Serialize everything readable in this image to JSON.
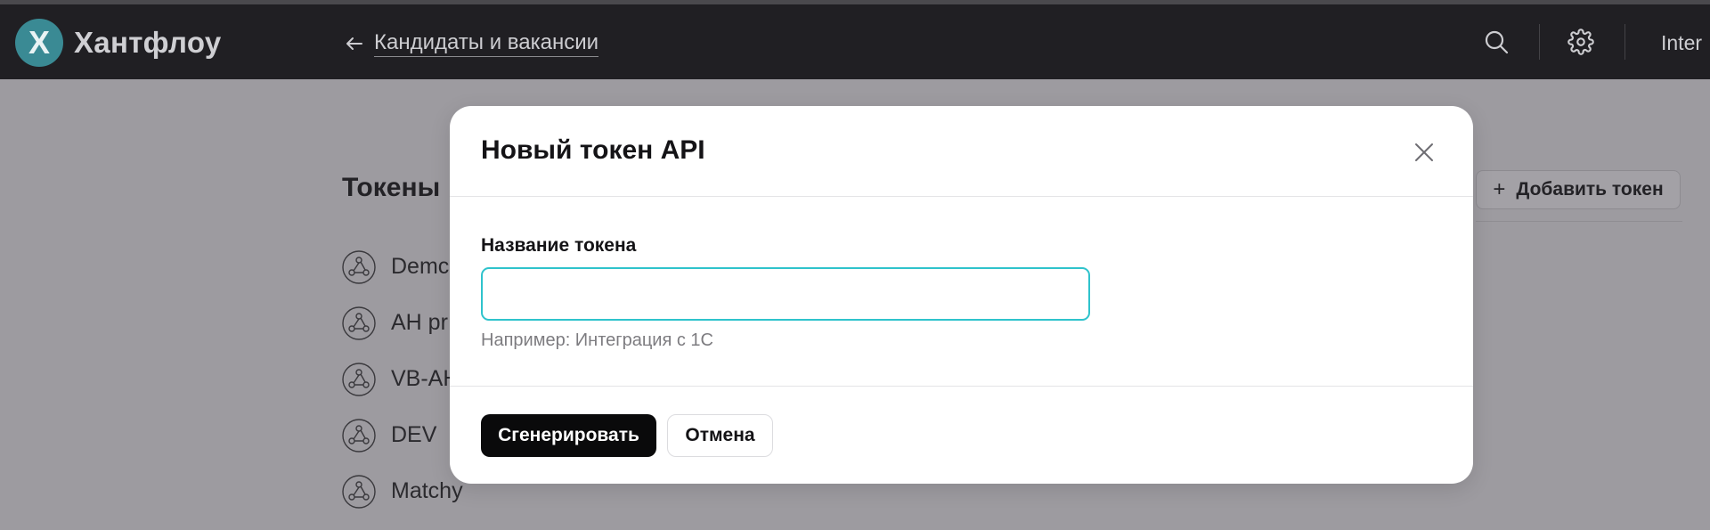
{
  "header": {
    "logo_letter": "X",
    "app_name": "Хантфлоу",
    "back_link": "Кандидаты и вакансии",
    "user_label": "Inter"
  },
  "page": {
    "title": "Токены",
    "add_token_button": "Добавить токен",
    "tokens": [
      {
        "name": "Demc"
      },
      {
        "name": "AH pr"
      },
      {
        "name": "VB-AH"
      },
      {
        "name": "DEV"
      },
      {
        "name": "Matchy"
      }
    ]
  },
  "modal": {
    "title": "Новый токен API",
    "field_label": "Название токена",
    "field_value": "",
    "field_hint": "Например: Интеграция с 1С",
    "generate_button": "Сгенерировать",
    "cancel_button": "Отмена"
  },
  "colors": {
    "header_bg": "#201f23",
    "logo_bg": "#3a8a94",
    "input_focus_border": "#2fc3cc",
    "primary_button_bg": "#0a0a0b",
    "overlay": "#9d9ba0"
  },
  "icons": {
    "back": "arrow-left-icon",
    "search": "search-icon",
    "settings": "gear-icon",
    "close": "close-icon",
    "plus": "plus-icon",
    "token": "webhook-icon"
  }
}
